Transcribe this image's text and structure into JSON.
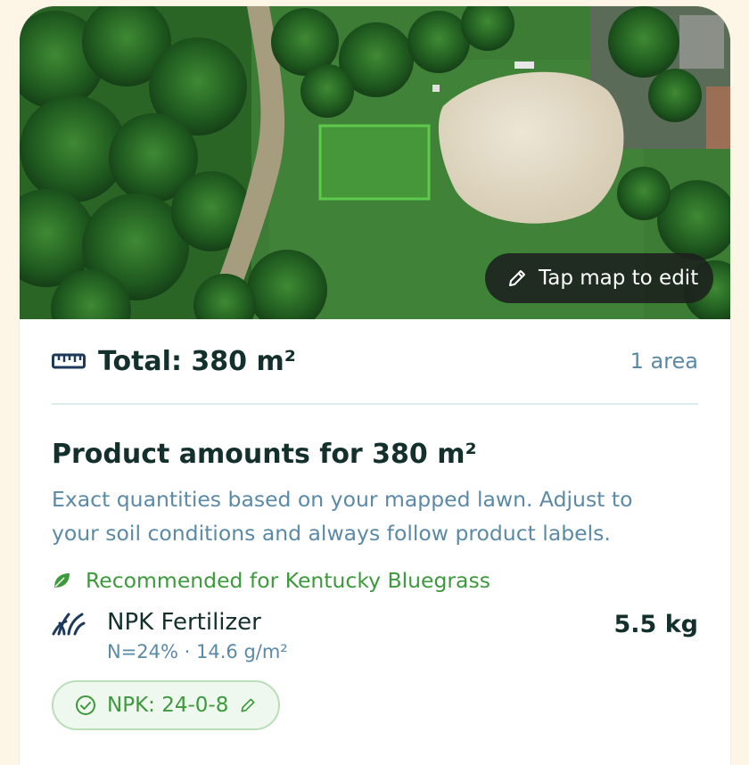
{
  "map": {
    "edit_label": "Tap map to edit"
  },
  "summary": {
    "total_label": "Total: 380 m²",
    "area_count": "1 area"
  },
  "products": {
    "title": "Product amounts for 380 m²",
    "description": "Exact quantities based on your mapped lawn. Adjust to your soil conditions and always follow product labels.",
    "recommendation": "Recommended for Kentucky Bluegrass",
    "items": [
      {
        "name": "NPK Fertilizer",
        "rate": "N=24% · 14.6 g/m²",
        "amount": "5.5 kg",
        "chip": "NPK: 24-0-8"
      }
    ]
  },
  "colors": {
    "accent_green": "#3c9a3c",
    "muted_blue": "#5a8aa6",
    "dark_text": "#14302c"
  },
  "icons": {
    "edit": "pencil-icon",
    "total": "ruler-icon",
    "recommendation": "leaf-icon",
    "product": "grass-icon",
    "chip_status": "check-circle-icon",
    "chip_edit": "pencil-icon"
  }
}
